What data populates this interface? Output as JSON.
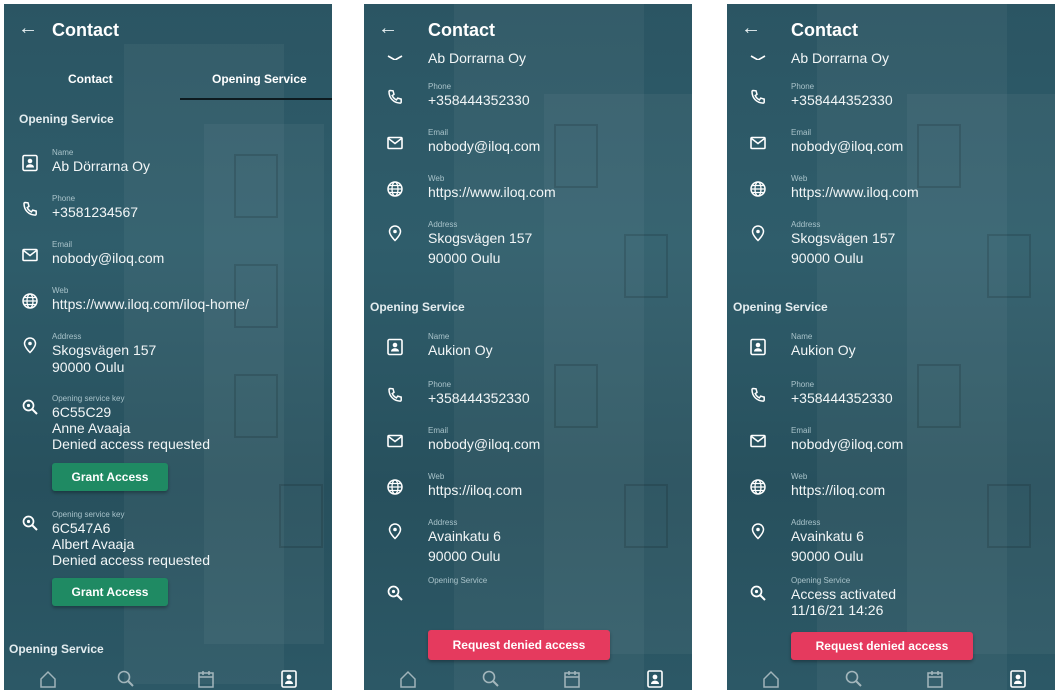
{
  "screen1": {
    "title": "Contact",
    "tabs": [
      "Contact",
      "Opening Service"
    ],
    "section": "Opening Service",
    "name_label": "Name",
    "name_value": "Ab Dörrarna Oy",
    "phone_label": "Phone",
    "phone_value": "+3581234567",
    "email_label": "Email",
    "email_value": "nobody@iloq.com",
    "web_label": "Web",
    "web_value": "https://www.iloq.com/iloq-home/",
    "address_label": "Address",
    "address_line1": "Skogsvägen 157",
    "address_line2": "90000 Oulu",
    "key1_label": "Opening service key",
    "key1_id": "6C55C29",
    "key1_person": "Anne Avaaja",
    "key1_status": "Denied access requested",
    "grant1": "Grant Access",
    "key2_label": "Opening service key",
    "key2_id": "6C547A6",
    "key2_person": "Albert Avaaja",
    "key2_status": "Denied access requested",
    "grant2": "Grant Access",
    "section_bottom": "Opening Service"
  },
  "screen2": {
    "title": "Contact",
    "top_name": "Ab Dorrarna Oy",
    "phone_label": "Phone",
    "phone_value": "+358444352330",
    "email_label": "Email",
    "email_value": "nobody@iloq.com",
    "web_label": "Web",
    "web_value": "https://www.iloq.com",
    "address_label": "Address",
    "address_line1": "Skogsvägen 157",
    "address_line2": "90000 Oulu",
    "section": "Opening Service",
    "name2_label": "Name",
    "name2_value": "Aukion Oy",
    "phone2_label": "Phone",
    "phone2_value": "+358444352330",
    "email2_label": "Email",
    "email2_value": "nobody@iloq.com",
    "web2_label": "Web",
    "web2_value": "https://iloq.com",
    "address2_label": "Address",
    "address2_line1": "Avainkatu 6",
    "address2_line2": "90000 Oulu",
    "opening_label": "Opening Service",
    "request_button": "Request denied access"
  },
  "screen3": {
    "title": "Contact",
    "top_name": "Ab Dorrarna Oy",
    "phone_label": "Phone",
    "phone_value": "+358444352330",
    "email_label": "Email",
    "email_value": "nobody@iloq.com",
    "web_label": "Web",
    "web_value": "https://www.iloq.com",
    "address_label": "Address",
    "address_line1": "Skogsvägen 157",
    "address_line2": "90000 Oulu",
    "section": "Opening Service",
    "name2_label": "Name",
    "name2_value": "Aukion Oy",
    "phone2_label": "Phone",
    "phone2_value": "+358444352330",
    "email2_label": "Email",
    "email2_value": "nobody@iloq.com",
    "web2_label": "Web",
    "web2_value": "https://iloq.com",
    "address2_label": "Address",
    "address2_line1": "Avainkatu 6",
    "address2_line2": "90000 Oulu",
    "opening_label": "Opening Service",
    "opening_status": "Access activated",
    "opening_time": "11/16/21 14:26",
    "request_button": "Request denied access"
  },
  "colors": {
    "background": "#2b5563",
    "grant": "#1f8a63",
    "request": "#e53a5e"
  },
  "icons": [
    "back-arrow-icon",
    "contact-card-icon",
    "phone-icon",
    "mail-icon",
    "globe-icon",
    "location-pin-icon",
    "key-search-icon",
    "home-icon",
    "calendar-icon"
  ]
}
